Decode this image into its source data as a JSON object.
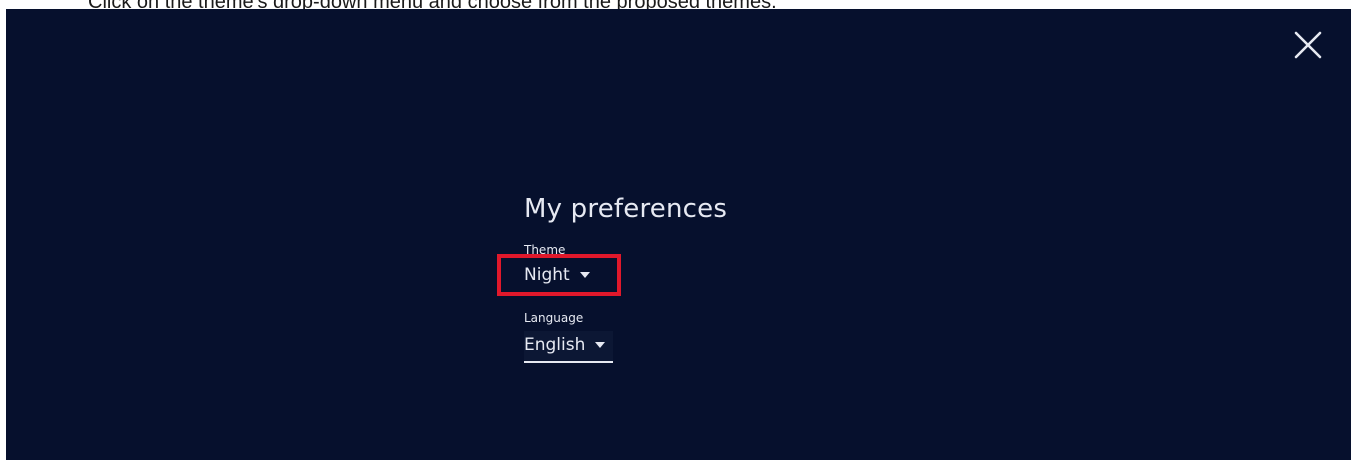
{
  "instruction": "Click on the theme's drop-down menu and choose from the proposed themes.",
  "dialog": {
    "close_icon": "close-icon",
    "title": "My preferences",
    "theme": {
      "label": "Theme",
      "value": "Night"
    },
    "language": {
      "label": "Language",
      "value": "English"
    }
  },
  "colors": {
    "background": "#06102d",
    "text": "#e6e9f2",
    "highlight": "#e0182b"
  }
}
